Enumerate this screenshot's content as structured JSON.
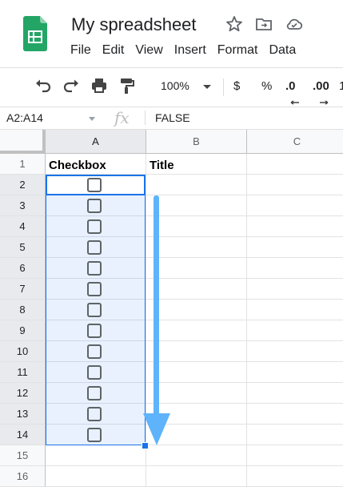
{
  "header": {
    "title": "My spreadsheet",
    "menu": [
      "File",
      "Edit",
      "View",
      "Insert",
      "Format",
      "Data"
    ]
  },
  "toolbar": {
    "zoom": "100%",
    "currency_symbol": "$",
    "percent_symbol": "%",
    "decrease_decimal": ".0",
    "increase_decimal": ".00",
    "more_formats": "1"
  },
  "formula_bar": {
    "name_box": "A2:A14",
    "fx_label": "fx",
    "value": "FALSE"
  },
  "sheet": {
    "columns": [
      "A",
      "B",
      "C"
    ],
    "rows": [
      "1",
      "2",
      "3",
      "4",
      "5",
      "6",
      "7",
      "8",
      "9",
      "10",
      "11",
      "12",
      "13",
      "14",
      "15",
      "16"
    ],
    "cells": {
      "A1": "Checkbox",
      "B1": "Title"
    },
    "checkbox_rows": [
      2,
      3,
      4,
      5,
      6,
      7,
      8,
      9,
      10,
      11,
      12,
      13,
      14
    ],
    "selection": "A2:A14"
  },
  "colors": {
    "logo_green": "#23a566",
    "selection_blue": "#1a73e8",
    "arrow_blue": "#5eb3fb"
  }
}
